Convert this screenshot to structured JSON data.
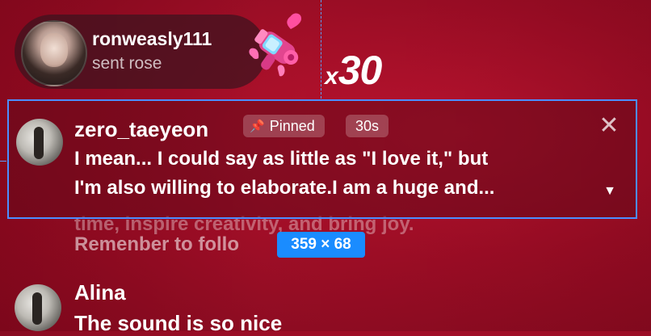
{
  "gift": {
    "username": "ronweasly111",
    "action": "sent rose",
    "count_prefix": "x",
    "count": "30",
    "icon": "heart-blaster-gift-icon"
  },
  "pinned_comment": {
    "username": "zero_taeyeon",
    "pinned_label": "Pinned",
    "time_label": "30s",
    "text_line1": "I mean... I could say as little as \"I love it,\" but",
    "text_line2": "I'm also willing to elaborate.I am a huge and...",
    "close_icon": "close-icon",
    "expand_icon": "chevron-down-icon",
    "highlight_color": "#4c8dff"
  },
  "background_comment": {
    "partial_line": "time, inspire creativity, and bring joy.",
    "text_visible": "Remenber to follo"
  },
  "size_badge": "359 × 68",
  "comments": [
    {
      "username": "Alina",
      "text": "The sound is so nice"
    }
  ],
  "colors": {
    "background": "#a10e27",
    "badge_blue": "#1a8cff"
  }
}
